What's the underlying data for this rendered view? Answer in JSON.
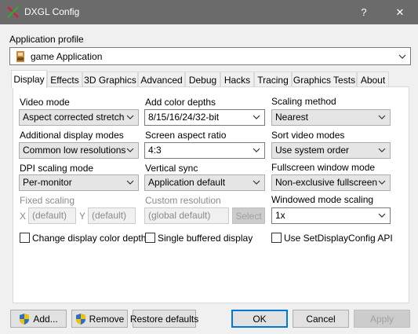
{
  "window": {
    "title": "DXGL Config",
    "help_label": "?",
    "close_label": "✕"
  },
  "profile": {
    "label": "Application profile",
    "selected": "game Application"
  },
  "tabs": [
    {
      "label": "Display",
      "active": true
    },
    {
      "label": "Effects"
    },
    {
      "label": "3D Graphics"
    },
    {
      "label": "Advanced"
    },
    {
      "label": "Debug"
    },
    {
      "label": "Hacks"
    },
    {
      "label": "Tracing"
    },
    {
      "label": "Graphics Tests"
    },
    {
      "label": "About"
    }
  ],
  "display": {
    "video_mode": {
      "label": "Video mode",
      "value": "Aspect corrected stretch"
    },
    "additional_modes": {
      "label": "Additional display modes",
      "value": "Common low resolutions"
    },
    "dpi_scaling": {
      "label": "DPI scaling mode",
      "value": "Per-monitor"
    },
    "fixed_scaling": {
      "label": "Fixed scaling",
      "x_label": "X",
      "x_value": "(default)",
      "y_label": "Y",
      "y_value": "(default)"
    },
    "color_depths": {
      "label": "Add color depths",
      "value": "8/15/16/24/32-bit"
    },
    "aspect_ratio": {
      "label": "Screen aspect ratio",
      "value": "4:3"
    },
    "vsync": {
      "label": "Vertical sync",
      "value": "Application default"
    },
    "custom_resolution": {
      "label": "Custom resolution",
      "value": "(global default)",
      "select_label": "Select"
    },
    "scaling_method": {
      "label": "Scaling method",
      "value": "Nearest"
    },
    "sort_modes": {
      "label": "Sort video modes",
      "value": "Use system order"
    },
    "fullscreen_mode": {
      "label": "Fullscreen window mode",
      "value": "Non-exclusive fullscreen"
    },
    "windowed_scaling": {
      "label": "Windowed mode scaling",
      "value": "1x"
    },
    "chk_color_depth": "Change display color depth",
    "chk_single_buffered": "Single buffered display",
    "chk_setdisplayconfig": "Use SetDisplayConfig API"
  },
  "buttons": {
    "add": "Add...",
    "remove": "Remove",
    "restore": "Restore defaults",
    "ok": "OK",
    "cancel": "Cancel",
    "apply": "Apply"
  },
  "colors": {
    "titlebar": "#6b6b6b",
    "accent": "#0078d7"
  }
}
